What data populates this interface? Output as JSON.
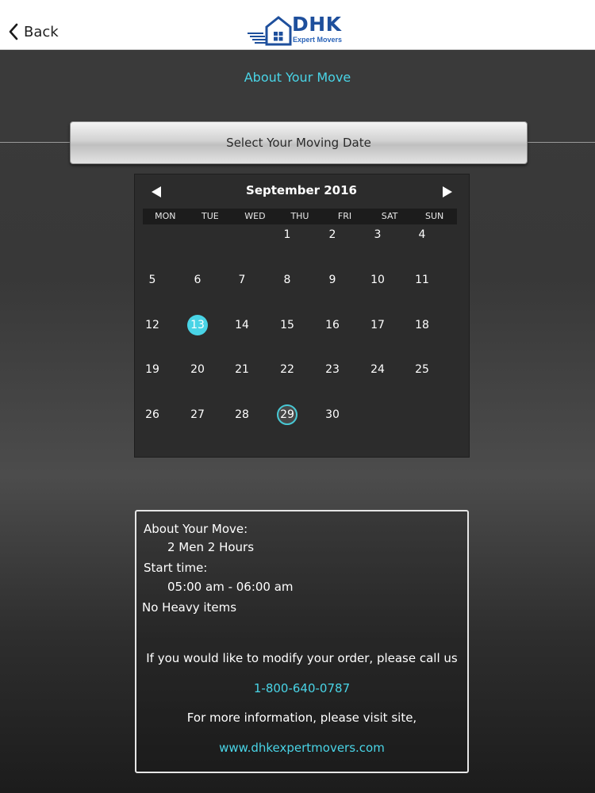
{
  "nav": {
    "back_label": "Back",
    "logo_text": "DHK",
    "logo_subtext": "Expert Movers"
  },
  "heading": "About Your Move",
  "select_date_label": "Select Your Moving Date",
  "calendar": {
    "month_label": "September 2016",
    "weekdays": [
      "MON",
      "TUE",
      "WED",
      "THU",
      "FRI",
      "SAT",
      "SUN"
    ],
    "days": [
      "1",
      "2",
      "3",
      "4",
      "5",
      "6",
      "7",
      "8",
      "9",
      "10",
      "11",
      "12",
      "13",
      "14",
      "15",
      "16",
      "17",
      "18",
      "19",
      "20",
      "21",
      "22",
      "23",
      "24",
      "25",
      "26",
      "27",
      "28",
      "29",
      "30"
    ],
    "selected_day": "13",
    "today_day": "29",
    "accent_color": "#49d4e6"
  },
  "info": {
    "about_label": "About Your Move:",
    "crew": "2 Men 2 Hours",
    "start_label": "Start time:",
    "start_value": "05:00 am - 06:00 am",
    "heavy_items": "No Heavy items",
    "modify_text": "If you would like to modify your order, please call us",
    "phone": "1-800-640-0787",
    "more_info_text": "For more information, please visit site,",
    "website": "www.dhkexpertmovers.com"
  }
}
